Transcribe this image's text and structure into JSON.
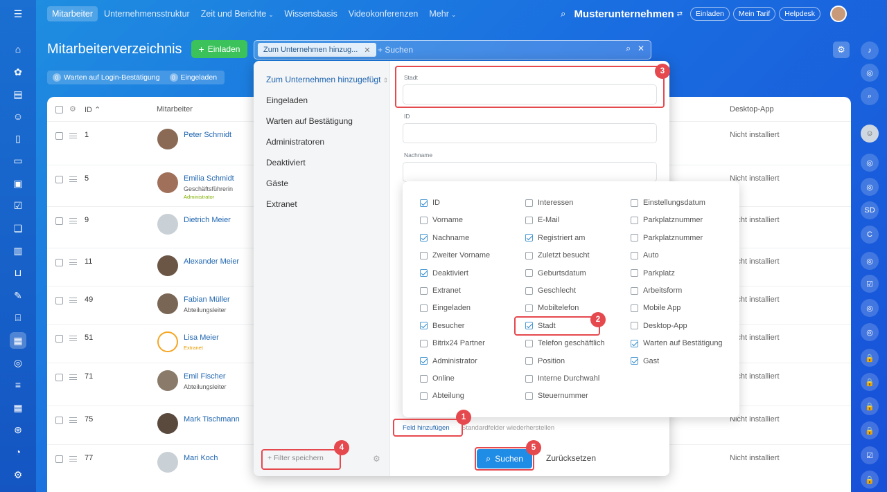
{
  "topnav": {
    "menu_icon": "menu-icon",
    "items": [
      "Mitarbeiter",
      "Unternehmensstruktur",
      "Zeit und Berichte",
      "Wissensbasis",
      "Videokonferenzen",
      "Mehr"
    ],
    "company": "Musterunternehmen",
    "invite": "Einladen",
    "tariff": "Mein Tarif",
    "helpdesk": "Helpdesk"
  },
  "page": {
    "title": "Mitarbeiterverzeichnis",
    "invite_btn": "Einladen",
    "filter_chip": "Zum Unternehmen hinzug...",
    "search_placeholder": "+ Suchen",
    "counter1_num": "0",
    "counter1_label": "Warten auf Login-Bestätigung",
    "counter2_num": "0",
    "counter2_label": "Eingeladen"
  },
  "table": {
    "col_id": "ID",
    "col_employee": "Mitarbeiter",
    "col_desktop": "Desktop-App",
    "rows": [
      {
        "id": "1",
        "name": "Peter Schmidt",
        "sub": "",
        "sub2": "",
        "desktop": "Nicht installiert"
      },
      {
        "id": "5",
        "name": "Emilia Schmidt",
        "sub": "Geschäftsführerin",
        "sub2": "Administrator",
        "desktop": "Nicht installiert"
      },
      {
        "id": "9",
        "name": "Dietrich Meier",
        "sub": "",
        "sub2": "",
        "desktop": "Nicht installiert"
      },
      {
        "id": "11",
        "name": "Alexander Meier",
        "sub": "",
        "sub2": "",
        "desktop": "Nicht installiert"
      },
      {
        "id": "49",
        "name": "Fabian Müller",
        "sub": "Abteilungsleiter",
        "sub2": "",
        "desktop": "Nicht installiert"
      },
      {
        "id": "51",
        "name": "Lisa Meier",
        "sub": "",
        "sub2": "Extranet",
        "desktop": "Nicht installiert"
      },
      {
        "id": "71",
        "name": "Emil Fischer",
        "sub": "Abteilungsleiter",
        "sub2": "",
        "desktop": "Nicht installiert"
      },
      {
        "id": "75",
        "name": "Mark Tischmann",
        "sub": "",
        "sub2": "",
        "desktop": "Nicht installiert"
      },
      {
        "id": "77",
        "name": "Mari Koch",
        "sub": "",
        "sub2": "",
        "desktop": "Nicht installiert"
      }
    ]
  },
  "filter": {
    "presets": [
      "Zum Unternehmen hinzugefügt",
      "Eingeladen",
      "Warten auf Bestätigung",
      "Administratoren",
      "Deaktiviert",
      "Gäste",
      "Extranet"
    ],
    "fields": [
      {
        "label": "Stadt"
      },
      {
        "label": "ID"
      },
      {
        "label": "Nachname"
      }
    ],
    "add_field": "Feld hinzufügen",
    "restore": "Standardfelder wiederherstellen",
    "save_filter": "+ Filter speichern",
    "search": "Suchen",
    "reset": "Zurücksetzen"
  },
  "field_menu": {
    "columns": [
      [
        {
          "label": "ID",
          "checked": true
        },
        {
          "label": "Vorname",
          "checked": false
        },
        {
          "label": "Nachname",
          "checked": true
        },
        {
          "label": "Zweiter Vorname",
          "checked": false
        },
        {
          "label": "Deaktiviert",
          "checked": true
        },
        {
          "label": "Extranet",
          "checked": false
        },
        {
          "label": "Eingeladen",
          "checked": false
        },
        {
          "label": "Besucher",
          "checked": true
        },
        {
          "label": "Bitrix24 Partner",
          "checked": false
        },
        {
          "label": "Administrator",
          "checked": true
        },
        {
          "label": "Online",
          "checked": false
        },
        {
          "label": "Abteilung",
          "checked": false
        }
      ],
      [
        {
          "label": "Interessen",
          "checked": false
        },
        {
          "label": "E-Mail",
          "checked": false
        },
        {
          "label": "Registriert am",
          "checked": true
        },
        {
          "label": "Zuletzt besucht",
          "checked": false
        },
        {
          "label": "Geburtsdatum",
          "checked": false
        },
        {
          "label": "Geschlecht",
          "checked": false
        },
        {
          "label": "Mobiltelefon",
          "checked": false
        },
        {
          "label": "Stadt",
          "checked": true
        },
        {
          "label": "Telefon geschäftlich",
          "checked": false
        },
        {
          "label": "Position",
          "checked": false
        },
        {
          "label": "Interne Durchwahl",
          "checked": false
        },
        {
          "label": "Steuernummer",
          "checked": false
        }
      ],
      [
        {
          "label": "Einstellungsdatum",
          "checked": false
        },
        {
          "label": "Parkplatznummer",
          "checked": false
        },
        {
          "label": "Parkplatznummer",
          "checked": false
        },
        {
          "label": "Auto",
          "checked": false
        },
        {
          "label": "Parkplatz",
          "checked": false
        },
        {
          "label": "Arbeitsform",
          "checked": false
        },
        {
          "label": "Mobile App",
          "checked": false
        },
        {
          "label": "Desktop-App",
          "checked": false
        },
        {
          "label": "Warten auf Bestätigung",
          "checked": true
        },
        {
          "label": "Gast",
          "checked": true
        }
      ]
    ]
  },
  "badges": [
    "1",
    "2",
    "3",
    "4",
    "5"
  ],
  "right_sidebar": {
    "sd": "SD",
    "c": "C"
  },
  "colors": {
    "accent": "#1f8ce6",
    "highlight": "#e5484d",
    "green": "#3bc25a"
  }
}
